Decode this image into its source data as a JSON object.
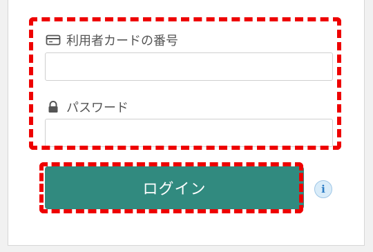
{
  "form": {
    "card_label": "利用者カードの番号",
    "card_value": "",
    "password_label": "パスワード",
    "password_value": "",
    "login_label": "ログイン",
    "info_glyph": "i"
  },
  "icons": {
    "card": "credit-card-icon",
    "password": "lock-icon",
    "info": "info-icon"
  },
  "colors": {
    "button": "#318a7f",
    "highlight": "#ee0000",
    "info": "#2b7bc4"
  }
}
